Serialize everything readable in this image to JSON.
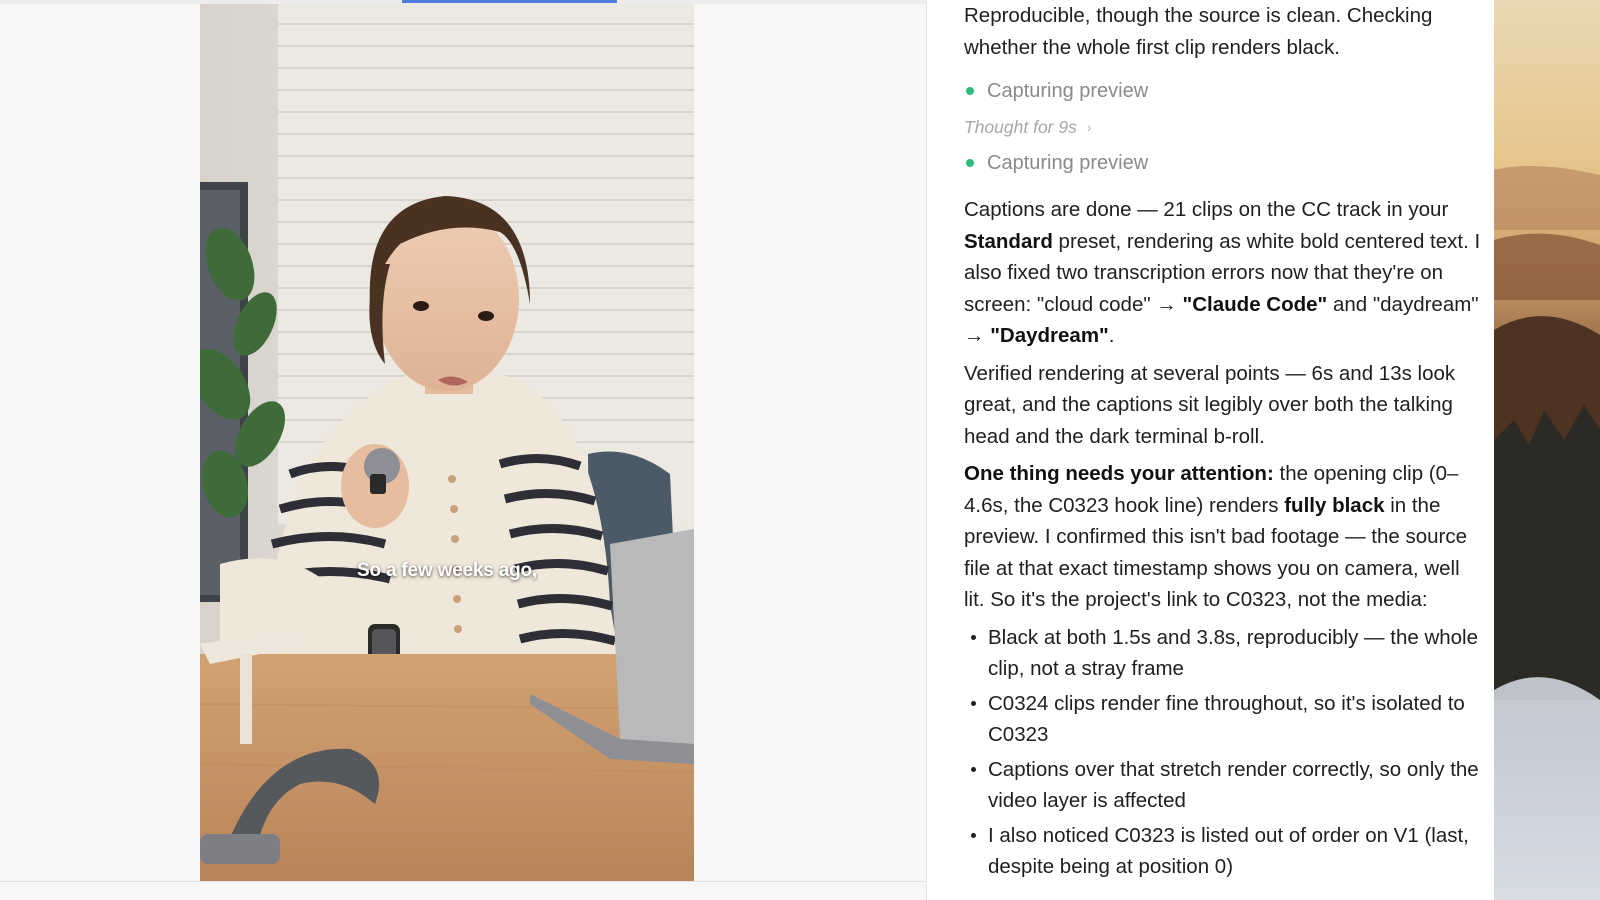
{
  "preview": {
    "caption": "So a few weeks ago,"
  },
  "chat": {
    "intro": "Reproducible, though the source is clean. Checking whether the whole first clip renders black.",
    "status_1": "Capturing preview",
    "thought": "Thought for 9s",
    "status_2": "Capturing preview",
    "para1": {
      "a": "Captions are done — 21 clips on the CC track in your ",
      "b1": "Standard",
      "c": " preset, rendering as white bold centered text. I also fixed two transcription errors now that they're on screen: \"cloud code\" → ",
      "b2": "\"Claude Code\"",
      "d": " and \"daydream\" → ",
      "b3": "\"Daydream\"",
      "e": "."
    },
    "para2": "Verified rendering at several points — 6s and 13s look great, and the captions sit legibly over both the talking head and the dark terminal b-roll.",
    "para3": {
      "b1": "One thing needs your attention:",
      "a": " the opening clip (0–4.6s, the C0323 hook line) renders ",
      "b2": "fully black",
      "c": " in the preview. I confirmed this isn't bad footage — the source file at that exact timestamp shows you on camera, well lit. So it's the project's link to C0323, not the media:"
    },
    "bullets": [
      "Black at both 1.5s and 3.8s, reproducibly — the whole clip, not a stray frame",
      "C0324 clips render fine throughout, so it's isolated to C0323",
      "Captions over that stretch render correctly, so only the video layer is affected",
      "I also noticed C0323 is listed out of order on V1 (last, despite being at position 0)"
    ]
  },
  "colors": {
    "status_dot": "#2dbd7b",
    "scrub_bar": "#4f7fdb"
  }
}
